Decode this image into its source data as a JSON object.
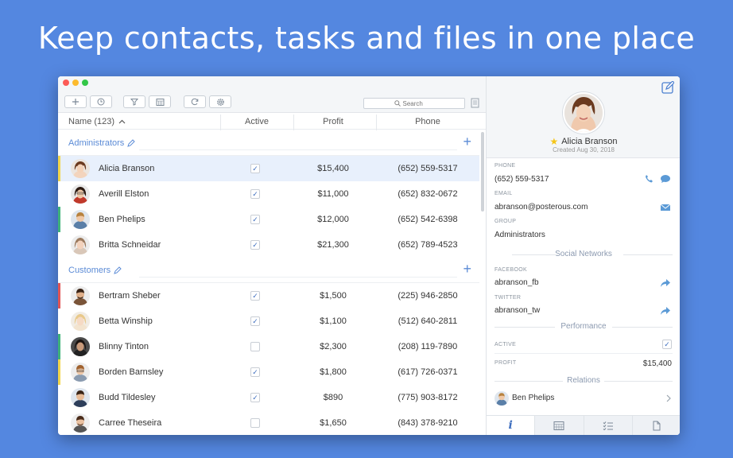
{
  "headline": "Keep contacts, tasks and files in one place",
  "toolbar": {
    "search_placeholder": "Search"
  },
  "columns": {
    "name": "Name (123)",
    "active": "Active",
    "profit": "Profit",
    "phone": "Phone"
  },
  "groups": [
    {
      "name": "Administrators"
    },
    {
      "name": "Customers"
    }
  ],
  "rows": [
    {
      "name": "Alicia Branson",
      "active": true,
      "profit": "$15,400",
      "phone": "(652) 559-5317",
      "strip": "#f2d64b"
    },
    {
      "name": "Averill Elston",
      "active": true,
      "profit": "$11,000",
      "phone": "(652) 832-0672",
      "strip": ""
    },
    {
      "name": "Ben Phelips",
      "active": true,
      "profit": "$12,000",
      "phone": "(652) 542-6398",
      "strip": "#3fb37a"
    },
    {
      "name": "Britta Schneidar",
      "active": true,
      "profit": "$21,300",
      "phone": "(652) 789-4523",
      "strip": ""
    },
    {
      "name": "Bertram Sheber",
      "active": true,
      "profit": "$1,500",
      "phone": "(225) 946-2850",
      "strip": "#e25555"
    },
    {
      "name": "Betta Winship",
      "active": true,
      "profit": "$1,100",
      "phone": "(512) 640-2811",
      "strip": ""
    },
    {
      "name": "Blinny Tinton",
      "active": false,
      "profit": "$2,300",
      "phone": "(208) 119-7890",
      "strip": "#3fb37a"
    },
    {
      "name": "Borden Barnsley",
      "active": true,
      "profit": "$1,800",
      "phone": "(617) 726-0371",
      "strip": "#f2d64b"
    },
    {
      "name": "Budd Tildesley",
      "active": true,
      "profit": "$890",
      "phone": "(775) 903-8172",
      "strip": ""
    },
    {
      "name": "Carree Theseira",
      "active": false,
      "profit": "$1,650",
      "phone": "(843) 378-9210",
      "strip": ""
    }
  ],
  "detail": {
    "name": "Alicia Branson",
    "created": "Created  Aug 30, 2018",
    "phone_label": "PHONE",
    "phone": "(652) 559-5317",
    "email_label": "EMAIL",
    "email": "abranson@posterous.com",
    "group_label": "GROUP",
    "group": "Administrators",
    "social_title": "Social Networks",
    "facebook_label": "FACEBOOK",
    "facebook": "abranson_fb",
    "twitter_label": "TWITTER",
    "twitter": "abranson_tw",
    "performance_title": "Performance",
    "active_label": "ACTIVE",
    "profit_label": "PROFIT",
    "profit": "$15,400",
    "relations_title": "Relations",
    "relation_name": "Ben Phelips"
  },
  "colors": {
    "accent": "#5b8bd6",
    "background": "#5487e0",
    "selected_row": "#e8f0fc"
  }
}
